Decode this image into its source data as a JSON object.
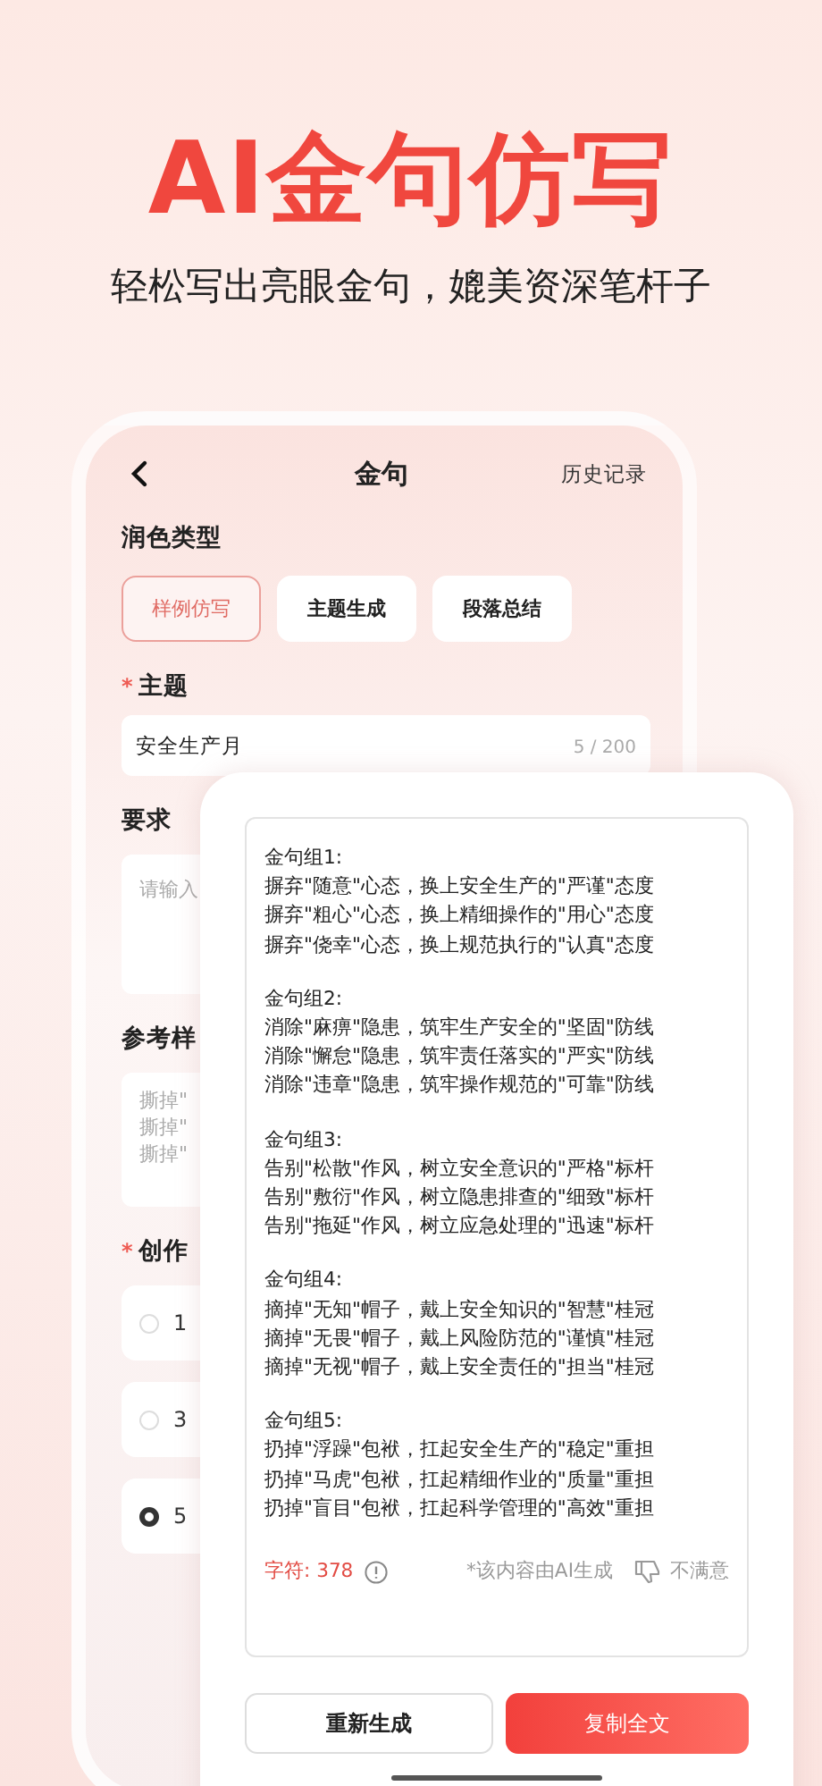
{
  "hero": {
    "title": "AI金句仿写",
    "subtitle": "轻松写出亮眼金句，媲美资深笔杆子"
  },
  "header": {
    "title": "金句",
    "action": "历史记录"
  },
  "polish_type": {
    "label": "润色类型",
    "options": [
      {
        "label": "样例仿写",
        "selected": true
      },
      {
        "label": "主题生成",
        "selected": false
      },
      {
        "label": "段落总结",
        "selected": false
      }
    ]
  },
  "topic": {
    "mark": "*",
    "label": "主题",
    "value": "安全生产月",
    "counter": "5 / 200"
  },
  "requirement": {
    "label": "要求",
    "placeholder": "请输入"
  },
  "reference": {
    "label": "参考样",
    "lines": [
      "撕掉\"",
      "撕掉\"",
      "撕掉\""
    ]
  },
  "count": {
    "mark": "*",
    "label": "创作",
    "options": [
      {
        "label": "1",
        "selected": false
      },
      {
        "label": "3",
        "selected": false
      },
      {
        "label": "5",
        "selected": true
      }
    ]
  },
  "result": {
    "groups": [
      {
        "title": "金句组1:",
        "lines": [
          "摒弃\"随意\"心态，换上安全生产的\"严谨\"态度",
          "摒弃\"粗心\"心态，换上精细操作的\"用心\"态度",
          "摒弃\"侥幸\"心态，换上规范执行的\"认真\"态度"
        ]
      },
      {
        "title": "金句组2:",
        "lines": [
          "消除\"麻痹\"隐患，筑牢生产安全的\"坚固\"防线",
          "消除\"懈怠\"隐患，筑牢责任落实的\"严实\"防线",
          "消除\"违章\"隐患，筑牢操作规范的\"可靠\"防线"
        ]
      },
      {
        "title": "金句组3:",
        "lines": [
          "告别\"松散\"作风，树立安全意识的\"严格\"标杆",
          "告别\"敷衍\"作风，树立隐患排查的\"细致\"标杆",
          "告别\"拖延\"作风，树立应急处理的\"迅速\"标杆"
        ]
      },
      {
        "title": "金句组4:",
        "lines": [
          "摘掉\"无知\"帽子，戴上安全知识的\"智慧\"桂冠",
          "摘掉\"无畏\"帽子，戴上风险防范的\"谨慎\"桂冠",
          "摘掉\"无视\"帽子，戴上安全责任的\"担当\"桂冠"
        ]
      },
      {
        "title": "金句组5:",
        "lines": [
          "扔掉\"浮躁\"包袱，扛起安全生产的\"稳定\"重担",
          "扔掉\"马虎\"包袱，扛起精细作业的\"质量\"重担",
          "扔掉\"盲目\"包袱，扛起科学管理的\"高效\"重担"
        ]
      }
    ],
    "char_count": "字符: 378",
    "ai_note": "*该内容由AI生成",
    "dislike": "不满意"
  },
  "buttons": [
    {
      "label": "重新生成",
      "kind": "secondary"
    },
    {
      "label": "复制全文",
      "kind": "primary"
    }
  ]
}
